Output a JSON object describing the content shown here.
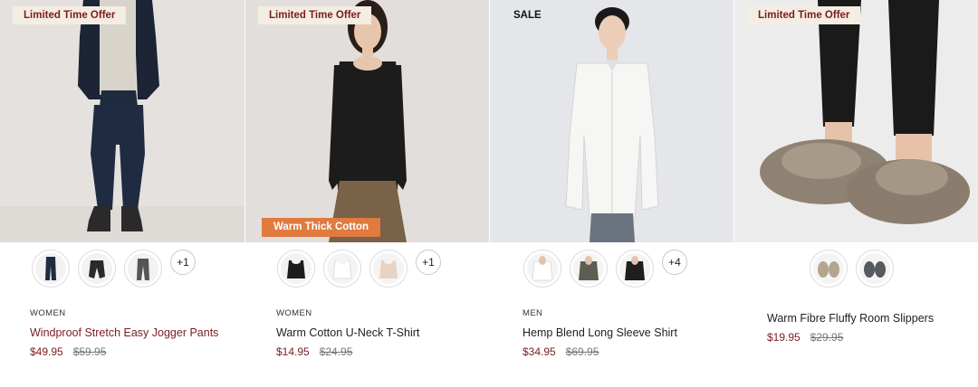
{
  "products": [
    {
      "badge": "Limited Time Offer",
      "category": "WOMEN",
      "name": "Windproof Stretch Easy Jogger Pants",
      "price": "$49.95",
      "was_price": "$59.95",
      "more_colors": "+1",
      "photo_bg": "#e4e1de"
    },
    {
      "badge": "Limited Time Offer",
      "feature_badge": "Warm Thick Cotton",
      "category": "WOMEN",
      "name": "Warm Cotton U-Neck T-Shirt",
      "price": "$14.95",
      "was_price": "$24.95",
      "more_colors": "+1",
      "photo_bg": "#e1dedb"
    },
    {
      "badge": "SALE",
      "category": "MEN",
      "name": "Hemp Blend Long Sleeve Shirt",
      "price": "$34.95",
      "was_price": "$69.95",
      "more_colors": "+4",
      "photo_bg": "#e4e6ea"
    },
    {
      "badge": "Limited Time Offer",
      "category": "",
      "name": "Warm Fibre Fluffy Room Slippers",
      "price": "$19.95",
      "was_price": "$29.95",
      "more_colors": "",
      "photo_bg": "#ececec"
    }
  ],
  "colors": {
    "accent_maroon": "#7a1d22",
    "badge_cream": "#f4ede2",
    "feature_orange": "#e07a3f"
  }
}
